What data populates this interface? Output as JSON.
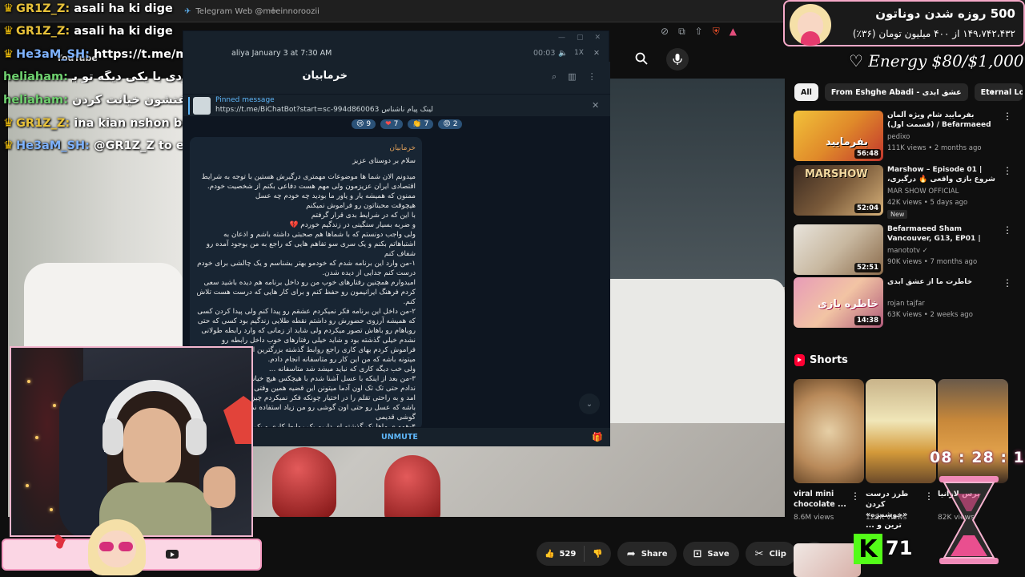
{
  "browser": {
    "tab_title": "Telegram Web @moeinnoroozii",
    "tab_new": "+"
  },
  "youtube": {
    "logo": "YouTube",
    "search_icon": "search-icon",
    "mic_icon": "mic-icon"
  },
  "chat": [
    {
      "name": "GR1Z_Z:",
      "message": "asali ha ki dige",
      "color": "gold",
      "crown": true
    },
    {
      "name": "GR1Z_Z:",
      "message": "asali ha ki dige",
      "color": "gold",
      "crown": true
    },
    {
      "name": "He3aM_SH:",
      "message": "https://t.me/moeinnoroozii",
      "color": "blue",
      "crown": true
    },
    {
      "name": "heliaham:",
      "message": "اینجاش جالبه که همچین مردی با یکی دیگه تو برنامه میگفت زن ستیز",
      "color": "green",
      "crown": false
    },
    {
      "name": "heliaham:",
      "message": "جفتشون خیانت کردن :)",
      "color": "green",
      "crown": false
    },
    {
      "name": "GR1Z_Z:",
      "message": "ina kian nshon bdid be man",
      "color": "gold",
      "crown": true
    },
    {
      "name": "He3aM_SH:",
      "message": "@GR1Z_Z to eshgh abadi boodan",
      "color": "blue",
      "crown": true
    }
  ],
  "telegram": {
    "player_title": "aliya January 3 at 7:30 AM",
    "player_time": "00:03",
    "player_speed": "1X",
    "channel_name": "خرمابیان",
    "pinned_title": "Pinned message",
    "pinned_body": "https://t.me/BiChatBot?start=sc-994d860063 لینک پیام ناشناس",
    "reactions": [
      {
        "emoji": "😢",
        "count": "9"
      },
      {
        "emoji": "❤",
        "count": "7"
      },
      {
        "emoji": "👏",
        "count": "7"
      },
      {
        "emoji": "😡",
        "count": "2"
      }
    ],
    "sender": "خرمابیان",
    "greeting": "سلام بر دوستای عزیز",
    "message": "میدونم الان شما ها موضوعات مهمتری درگیرش هستین  با توجه به شرایط اقتصادی ایران عزیزمون ولی مهم هست دفاعی بکنم از شخصیت خودم. ممنون که همیشه یار و یاور ما بودید چه خودم چه عسل\nهیچوقت محبتاتون رو فراموش نمیکنم\nبا این که در شرایط بدی قرار گرفتم\nو ضربه بسیار سنگینی در زندگیم خوردم 💔\nولی واجب دونستم که با شماها هم صحبتی داشته باشم و اذعان به اشتباهاتم بکنم و یک سری سو تفاهم هایی که راجع به من بوجود آمده رو شفاف کنم\n۱-من وارد این برنامه شدم که خودمو بهتر بشناسم و یک چالشی برای خودم درست کنم جدایی از دیده شدن.\nامیدوارم همچنین رفتارهای خوب من رو داخل برنامه هم دیده باشید سعی کردم فرهنگ ایرانیمون رو حفظ کنم و برای کار هایی که درست هست تلاش کنم.\n۲-من داخل این برنامه فکر نمیکردم عشقم رو پیدا کنم ولی پیدا کردن کسی که همیشه آرزوی حضورش رو داشتم نقطه طلایی زندگیم بود کسی که حتی رویاهام رو باهاش تصور میکردم ولی شاید از زمانی که وارد رابطه طولانی نشدم خیلی گذشته بود و شاید خیلی رفتارهای خوب داخل رابطه رو فراموش کردم بهای کاری راجع روابط گذشته بزرگترین اشتباه هر کسی میتونه باشه که من این کار رو متاسفانه انجام دادم.\nولی خب دیگه کاری که نباید میشد شد متاسفانه ...\n۳-من بعد از اینکه با عسل آشنا شدم با هیچکس هیچ خیانت احساسی انجام ندادم حتی تک تک اون آدما میتونن این قضیه همین وقتی که شکی به وجود امد و به راحتی تقلم را در اختیار چونکه فکر نمیکردم چیزی داخل گوشیم باشه که عسل رو حتی اون گوشی رو من زیاد استفاده نمیکردم و در واقع گوشی قدیمی\n۴-همه ی ماها یک گذشته ای داریم یک روابط کاری و یک سری گذشته خود اون آدم مربوطه و خیلی از چیزهایی که راجع به من سال های قبل و قبل از برنامه بوده. من و عسل راجع به گذشته",
    "unmute": "UNMUTE"
  },
  "donation": {
    "title": "500 روزه شدن دوناتون",
    "amount": "۱۴۹،۷۴۲،۴۳۲ از ۴۰۰ میلیون تومان (۳۶٪)"
  },
  "energy": "♡ Energy $80/$1,000",
  "sidebar": {
    "chips": [
      "All",
      "From Eshghe Abadi - عشق ابدی",
      "Eternal Love"
    ],
    "recommendations": [
      {
        "title": "بفرمایید شام ویژه آلمان (قسمت اول) / Befarmaeed sham Germany ...",
        "channel": "pedixo",
        "meta": "111K views • 2 months ago",
        "duration": "56:48",
        "badge": ""
      },
      {
        "title": "Marshow – Episode 01 | شروع بازی واقعی 🔥 درگیری، راز و خیانت",
        "channel": "MAR SHOW OFFICIAL",
        "meta": "42K views • 5 days ago",
        "duration": "52:04",
        "badge": "New"
      },
      {
        "title": "Befarmaeed Sham Vancouver, G13, EP01 | بفرمایید شام، ونکوور ...",
        "channel": "manototv ✓",
        "meta": "90K views • 7 months ago",
        "duration": "52:51",
        "badge": ""
      },
      {
        "title": "خاطرت ما از عشق ابدی",
        "channel": "rojan tajfar",
        "meta": "63K views • 2 weeks ago",
        "duration": "14:38",
        "badge": ""
      }
    ],
    "shorts_label": "Shorts",
    "shorts": [
      {
        "title": "viral mini chocolate ...",
        "views": "8.6M views"
      },
      {
        "title": "طرز درست کردن «خوشمزه» ترین و ...",
        "views": "128K views"
      },
      {
        "title": "پرس لازانیا",
        "views": "82K views"
      }
    ]
  },
  "video_actions": {
    "likes": "529",
    "share": "Share",
    "save": "Save",
    "clip": "Clip"
  },
  "timer": "08 : 28 : 13",
  "kick_count": "71",
  "colors": {
    "tg_accent": "#5eb5f7",
    "pink_frame": "#f49ac0",
    "kick_green": "#53fc18"
  }
}
